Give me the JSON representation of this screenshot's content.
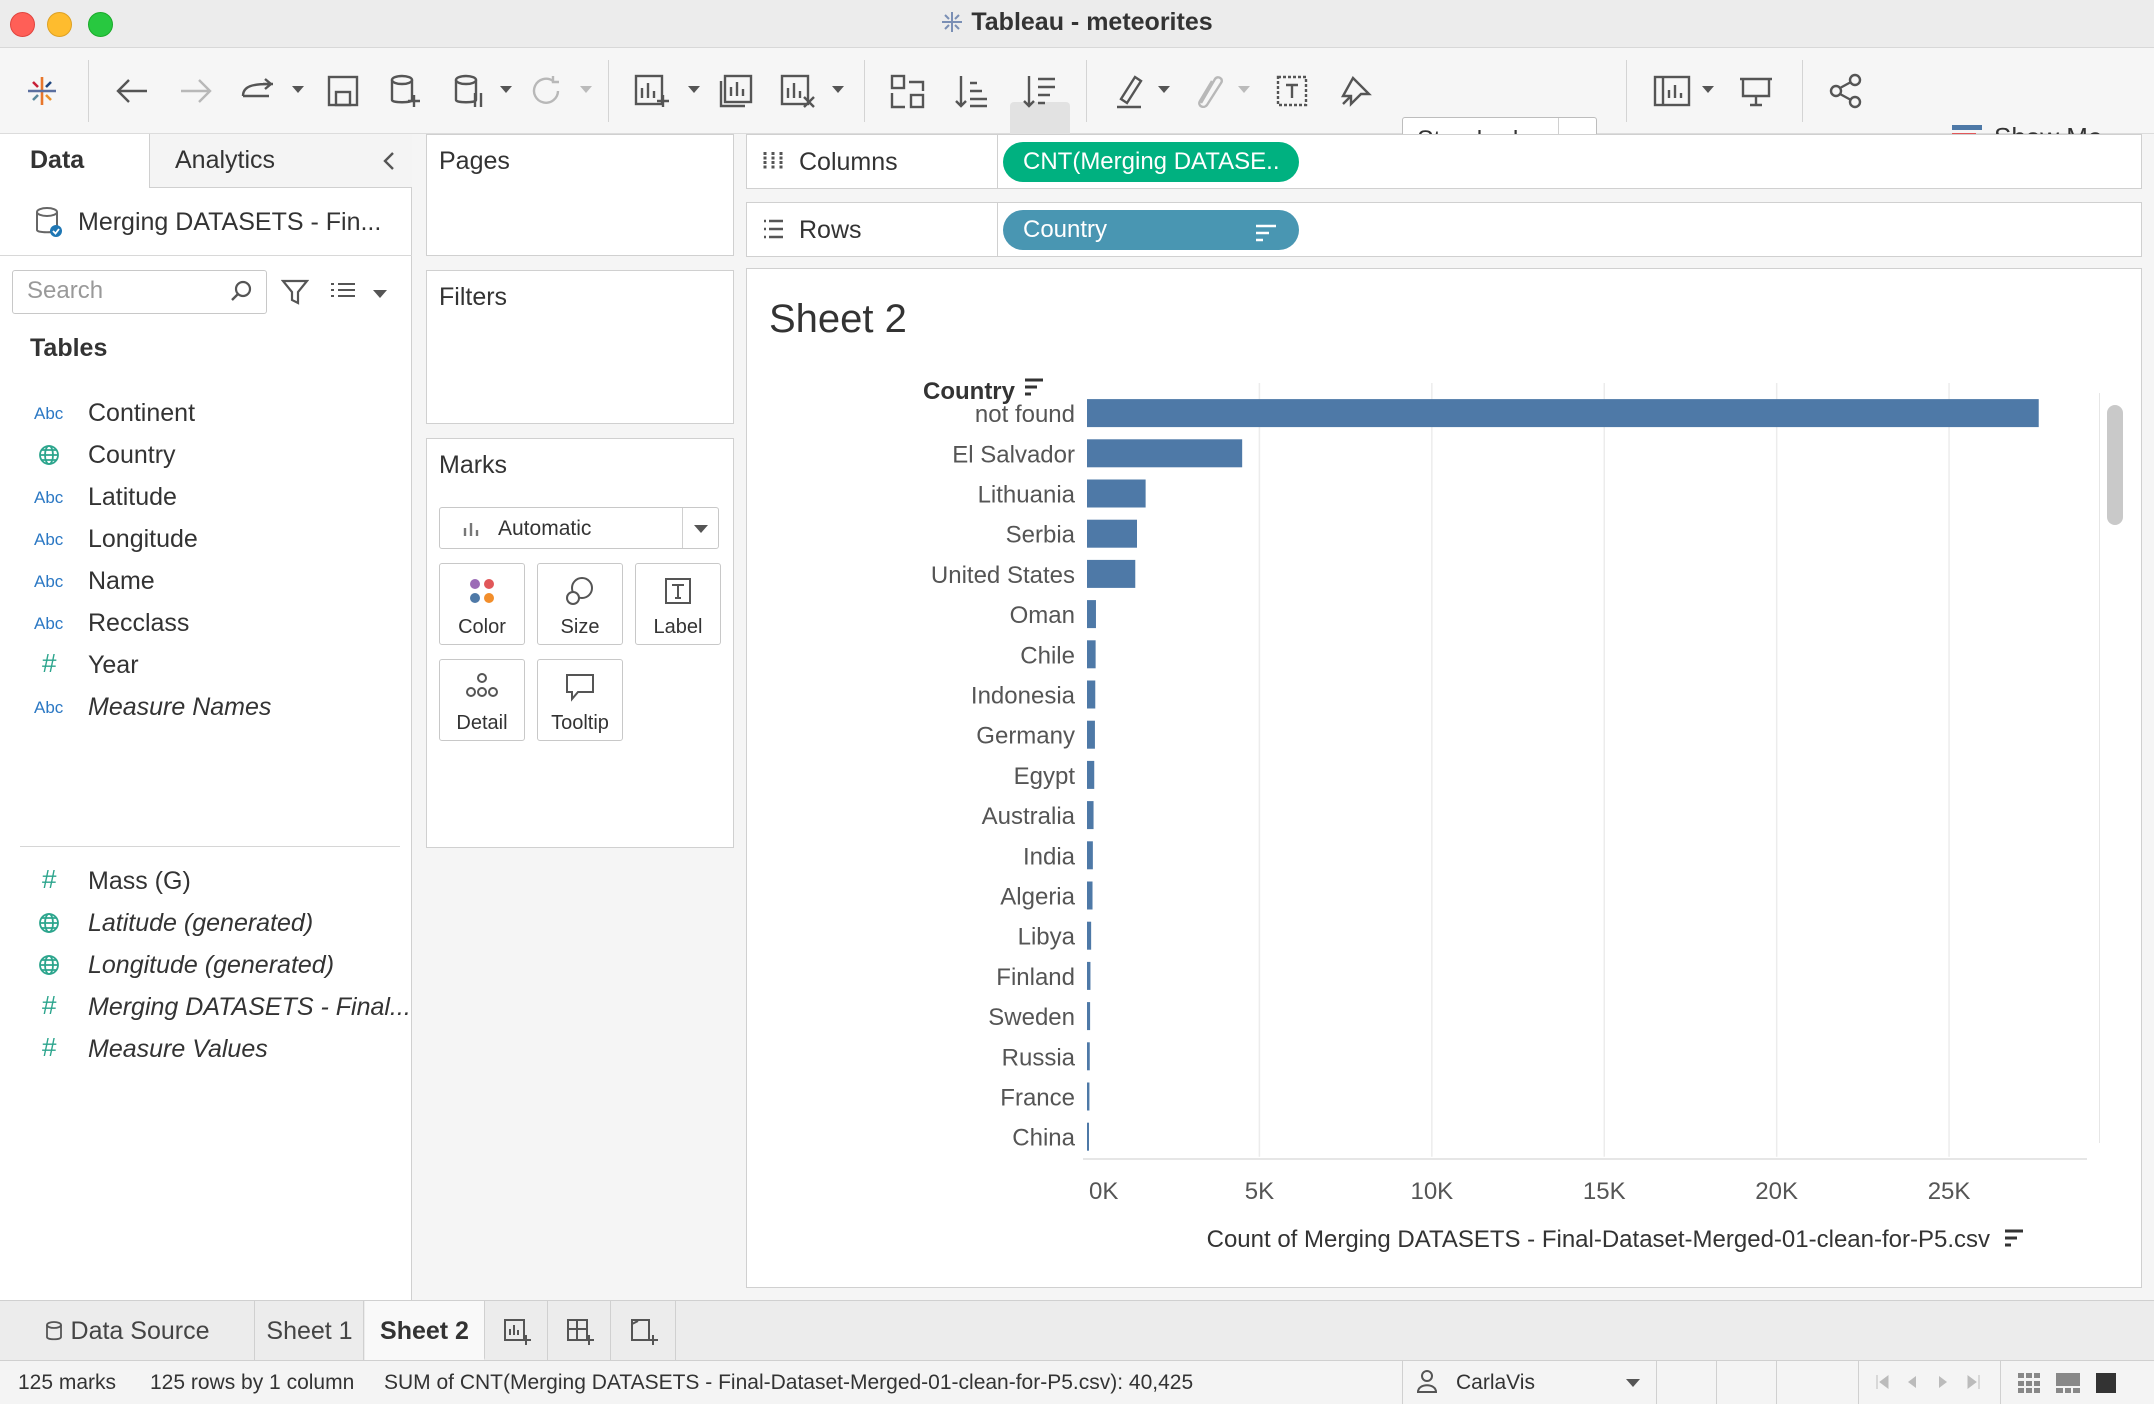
{
  "window": {
    "title": "Tableau - meteorites"
  },
  "toolbar": {
    "mark_type_select": "Standard",
    "show_me_label": "Show Me"
  },
  "data_pane": {
    "tab_data": "Data",
    "tab_analytics": "Analytics",
    "datasource_name": "Merging DATASETS - Fin...",
    "search_placeholder": "Search",
    "tables_header": "Tables",
    "dimensions": [
      {
        "icon": "abc",
        "label": "Continent"
      },
      {
        "icon": "globe",
        "label": "Country"
      },
      {
        "icon": "abc",
        "label": "Latitude"
      },
      {
        "icon": "abc",
        "label": "Longitude"
      },
      {
        "icon": "abc",
        "label": "Name"
      },
      {
        "icon": "abc",
        "label": "Recclass"
      },
      {
        "icon": "number",
        "label": "Year"
      },
      {
        "icon": "abc",
        "label": "Measure Names"
      }
    ],
    "measures": [
      {
        "icon": "number",
        "label": "Mass (G)"
      },
      {
        "icon": "globe",
        "label": "Latitude (generated)"
      },
      {
        "icon": "globe",
        "label": "Longitude (generated)"
      },
      {
        "icon": "number",
        "label": "Merging DATASETS - Final..."
      },
      {
        "icon": "number",
        "label": "Measure Values"
      }
    ],
    "abc_icon_text": "Abc",
    "number_icon_text": "#"
  },
  "cards": {
    "pages": "Pages",
    "filters": "Filters",
    "marks": "Marks",
    "marks_type": "Automatic",
    "buttons": {
      "color": "Color",
      "size": "Size",
      "label": "Label",
      "detail": "Detail",
      "tooltip": "Tooltip"
    }
  },
  "shelves": {
    "columns_label": "Columns",
    "columns_pill": "CNT(Merging DATASE..",
    "rows_label": "Rows",
    "rows_pill": "Country"
  },
  "sheet": {
    "title": "Sheet 2"
  },
  "chart_data": {
    "type": "bar",
    "orientation": "horizontal",
    "row_header": "Country",
    "categories": [
      "not found",
      "El Salvador",
      "Lithuania",
      "Serbia",
      "United States",
      "Oman",
      "Chile",
      "Indonesia",
      "Germany",
      "Egypt",
      "Australia",
      "India",
      "Algeria",
      "Libya",
      "Finland",
      "Sweden",
      "Russia",
      "France",
      "China"
    ],
    "values": [
      27600,
      4500,
      1700,
      1450,
      1400,
      260,
      250,
      240,
      230,
      210,
      190,
      170,
      160,
      120,
      100,
      90,
      80,
      70,
      40
    ],
    "xlabel": "Count of Merging DATASETS - Final-Dataset-Merged-01-clean-for-P5.csv",
    "xticks": [
      "0K",
      "5K",
      "10K",
      "15K",
      "20K",
      "25K"
    ],
    "xlim": [
      0,
      29000
    ],
    "bar_color": "#4e79a7",
    "grid": true
  },
  "sheet_tabs": {
    "data_source": "Data Source",
    "sheet1": "Sheet 1",
    "sheet2": "Sheet 2"
  },
  "status": {
    "marks": "125 marks",
    "rows_cols": "125 rows by 1 column",
    "sum": "SUM of CNT(Merging DATASETS - Final-Dataset-Merged-01-clean-for-P5.csv): 40,425",
    "user": "CarlaVis"
  }
}
